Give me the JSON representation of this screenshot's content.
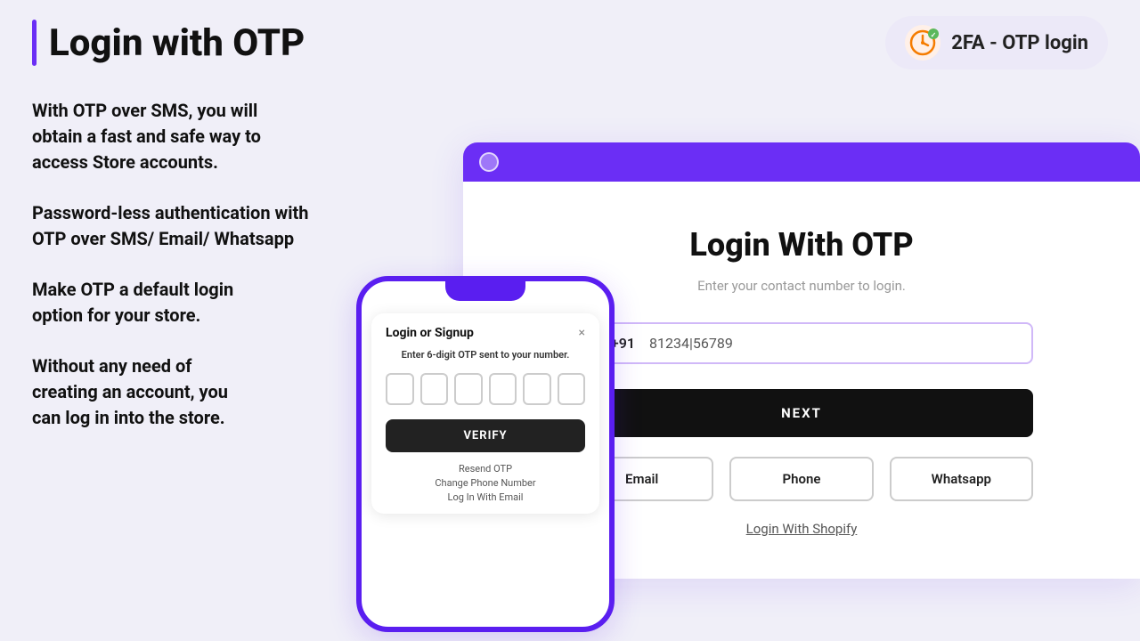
{
  "header": {
    "title": "Login with OTP",
    "brand": {
      "label": "2FA - OTP login"
    }
  },
  "features": [
    "With OTP over SMS, you will obtain a fast and safe way to access Store accounts.",
    "Password-less authentication with OTP over SMS/ Email/ Whatsapp",
    "Make OTP a default login option for your store.",
    "Without any need of creating an account, you can log in into the store."
  ],
  "phone_modal": {
    "title": "Login or Signup",
    "close": "×",
    "subtitle": "Enter 6-digit OTP sent to your number.",
    "verify_btn": "VERIFY",
    "resend_link": "Resend OTP",
    "change_link": "Change Phone Number",
    "email_link": "Log In With Email"
  },
  "browser_panel": {
    "title": "Login With OTP",
    "subtitle": "Enter your contact number to login.",
    "flag": "🇮🇳",
    "country_code": "+91",
    "phone_placeholder": "81234|56789",
    "next_btn": "NEXT",
    "login_options": [
      "Email",
      "Phone",
      "Whatsapp"
    ],
    "shopify_link": "Login With Shopify"
  }
}
